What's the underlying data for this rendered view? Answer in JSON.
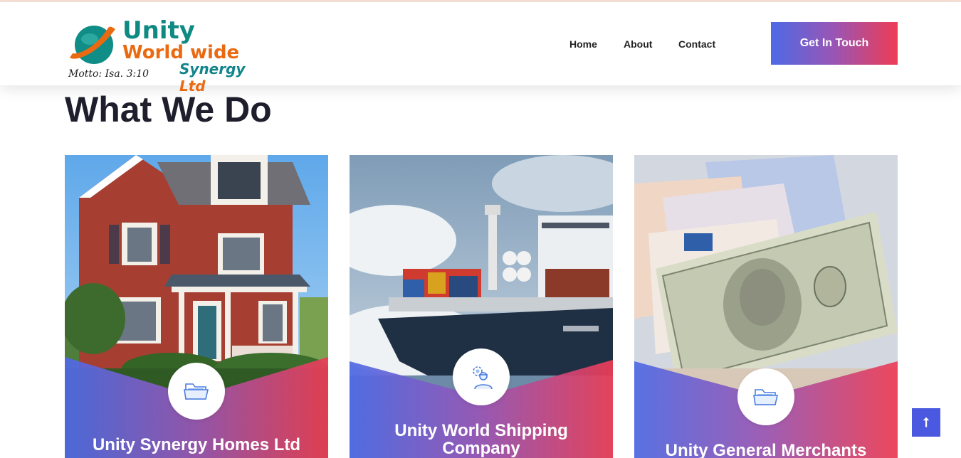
{
  "logo": {
    "line1": "Unity",
    "line2": "World wide",
    "line3": "Synergy",
    "line3_suffix": "Ltd",
    "motto": "Motto: Isa. 3:10",
    "colors": {
      "teal": "#0e8a83",
      "orange": "#ea6a12"
    }
  },
  "nav": {
    "items": [
      {
        "label": "Home"
      },
      {
        "label": "About"
      },
      {
        "label": "Contact"
      }
    ],
    "cta_label": "Get In Touch"
  },
  "section": {
    "title": "What We Do"
  },
  "cards": [
    {
      "title": "Unity Synergy Homes Ltd",
      "icon": "folder-icon",
      "image": "red-house-photo"
    },
    {
      "title_line1": "Unity World Shipping",
      "title_line2": "Company",
      "icon": "engineer-gear-icon",
      "image": "cargo-ship-photo"
    },
    {
      "title": "Unity General Merchants",
      "icon": "folder-icon",
      "image": "dollar-banknotes-photo"
    }
  ],
  "scroll_top": {
    "icon": "arrow-up-icon",
    "glyph": "⭡"
  },
  "colors": {
    "gradient_start": "#4d6ae6",
    "gradient_mid": "#9a55b4",
    "gradient_end": "#ee3c54",
    "heading": "#1e1e2c",
    "scroll_button": "#4b58e0"
  }
}
